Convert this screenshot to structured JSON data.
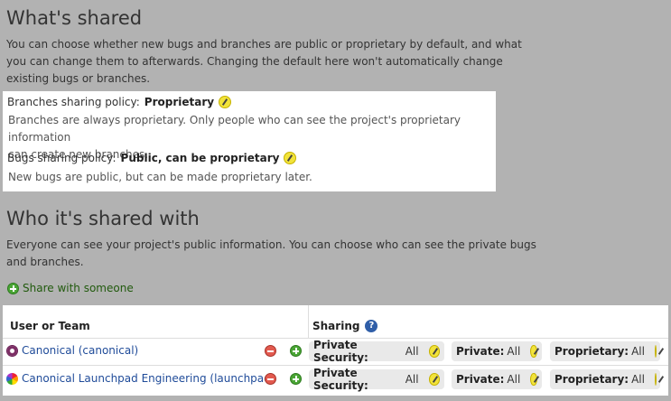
{
  "whats_shared": {
    "heading": "What's shared",
    "intro_line1": "You can choose whether new bugs and branches are public or proprietary by default, and what",
    "intro_line2": "you can change them to afterwards. Changing the default here won't automatically change",
    "intro_line3": "existing bugs or branches."
  },
  "policies": {
    "branches": {
      "label": "Branches sharing policy:",
      "value": "Proprietary",
      "desc_line1": "Branches are always proprietary. Only people who can see the project's proprietary information",
      "desc_line2": "can create new branches."
    },
    "bugs": {
      "label": "Bugs sharing policy:",
      "value": "Public, can be proprietary",
      "desc_line1": "New bugs are public, but can be made proprietary later."
    }
  },
  "who_shared": {
    "heading": "Who it's shared with",
    "intro_line1": "Everyone can see your project's public information. You can choose who can see the private bugs",
    "intro_line2": "and branches.",
    "share_link": "Share with someone"
  },
  "table": {
    "col_user": "User or Team",
    "col_sharing": "Sharing",
    "help_glyph": "?",
    "rows": [
      {
        "name": "Canonical (canonical)",
        "icon": "team-icon",
        "private_security_label": "Private Security:",
        "private_security_value": "All",
        "private_label": "Private:",
        "private_value": "All",
        "proprietary_label": "Proprietary:",
        "proprietary_value": "All"
      },
      {
        "name": "Canonical Launchpad Engineering (launchpad)",
        "icon": "team-icon",
        "private_security_label": "Private Security:",
        "private_security_value": "All",
        "private_label": "Private:",
        "private_value": "All",
        "proprietary_label": "Proprietary:",
        "proprietary_value": "All"
      }
    ]
  },
  "colors": {
    "background": "#b2b2b2",
    "link": "#1f4b99",
    "share_link": "#215a0d",
    "edit_icon": "#f2e33a"
  }
}
